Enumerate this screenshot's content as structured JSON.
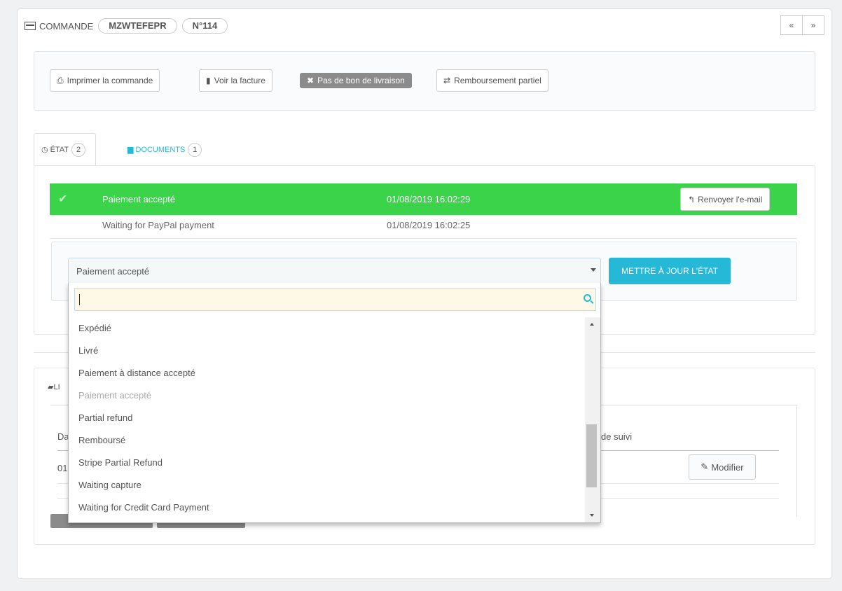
{
  "header": {
    "title": "COMMANDE",
    "reference": "MZWTEFEPR",
    "number": "N°114"
  },
  "nav": {
    "prev_icon": "«",
    "next_icon": "»"
  },
  "toolbar": {
    "print": "Imprimer la commande",
    "invoice": "Voir la facture",
    "no_delivery": "Pas de bon de livraison",
    "refund": "Remboursement partiel"
  },
  "tabs": {
    "state": {
      "label": "ÉTAT",
      "count": "2"
    },
    "documents": {
      "label": "DOCUMENTS",
      "count": "1"
    }
  },
  "history": [
    {
      "status": "Paiement accepté",
      "date": "01/08/2019 16:02:29"
    },
    {
      "status": "Waiting for PayPal payment",
      "date": "01/08/2019 16:02:25"
    }
  ],
  "resend_label": "Renvoyer l'e-mail",
  "state_select": {
    "value": "Paiement accepté",
    "update_label": "METTRE À JOUR L'ÉTAT",
    "options": [
      "Expédié",
      "Livré",
      "Paiement à distance accepté",
      "Paiement accepté",
      "Partial refund",
      "Remboursé",
      "Stripe Partial Refund",
      "Waiting capture",
      "Waiting for Credit Card Payment"
    ]
  },
  "shipping": {
    "tab_partial": "LI",
    "col_date_partial": "Da",
    "row_date_partial": "01",
    "col_tracking_partial": "de suivi",
    "modify_label": "Modifier"
  },
  "colors": {
    "accent": "#25b9d7",
    "success": "#3ad34a"
  }
}
